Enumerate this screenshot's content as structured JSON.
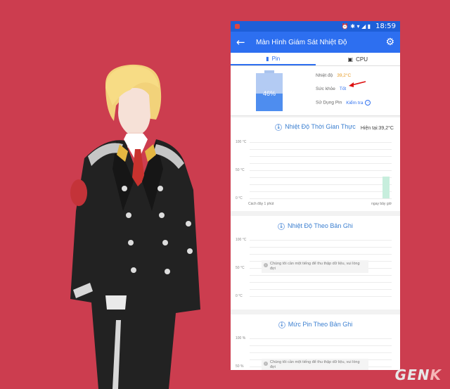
{
  "status": {
    "time": "18:59",
    "icons": "⏰ ✱ ▾ ◢ ▮"
  },
  "appbar": {
    "back_icon": "←",
    "title": "Màn Hình Giám Sát Nhiệt Độ",
    "settings_icon": "⚙"
  },
  "tabs": [
    {
      "label": "Pin",
      "icon": "▮"
    },
    {
      "label": "CPU",
      "icon": "▣"
    }
  ],
  "battery": {
    "percent_label": "46%",
    "level": 0.46,
    "temp_label": "Nhiệt độ",
    "temp_value": "39,2°C",
    "health_label": "Sức khỏe",
    "health_value": "Tốt",
    "usage_label": "Sử Dụng Pin",
    "usage_value": "Kiểm tra"
  },
  "realtime": {
    "title": "Nhiệt Độ Thời Gian Thực",
    "current": "Hiện tại:39,2°C",
    "y_labels": [
      "100 °C",
      "50 °C",
      "0 °C"
    ],
    "x_start": "Cách đây 1 phút",
    "x_end": "ngay bây giờ",
    "latest_value": 39.2,
    "ylim": [
      0,
      100
    ]
  },
  "history_temp": {
    "title": "Nhiệt Độ Theo Bản Ghi",
    "y_labels": [
      "100 °C",
      "50 °C",
      "0 °C"
    ],
    "note": "Chúng tôi cần một tiếng để thu thập dữ liệu, vui lòng đợi"
  },
  "history_battery": {
    "title": "Mức Pin Theo Bản Ghi",
    "y_labels": [
      "100 %",
      "50 %"
    ],
    "note": "Chúng tôi cần một tiếng để thu thập dữ liệu, vui lòng đợi"
  },
  "watermark": {
    "text_a": "GEN",
    "text_b": "K"
  }
}
